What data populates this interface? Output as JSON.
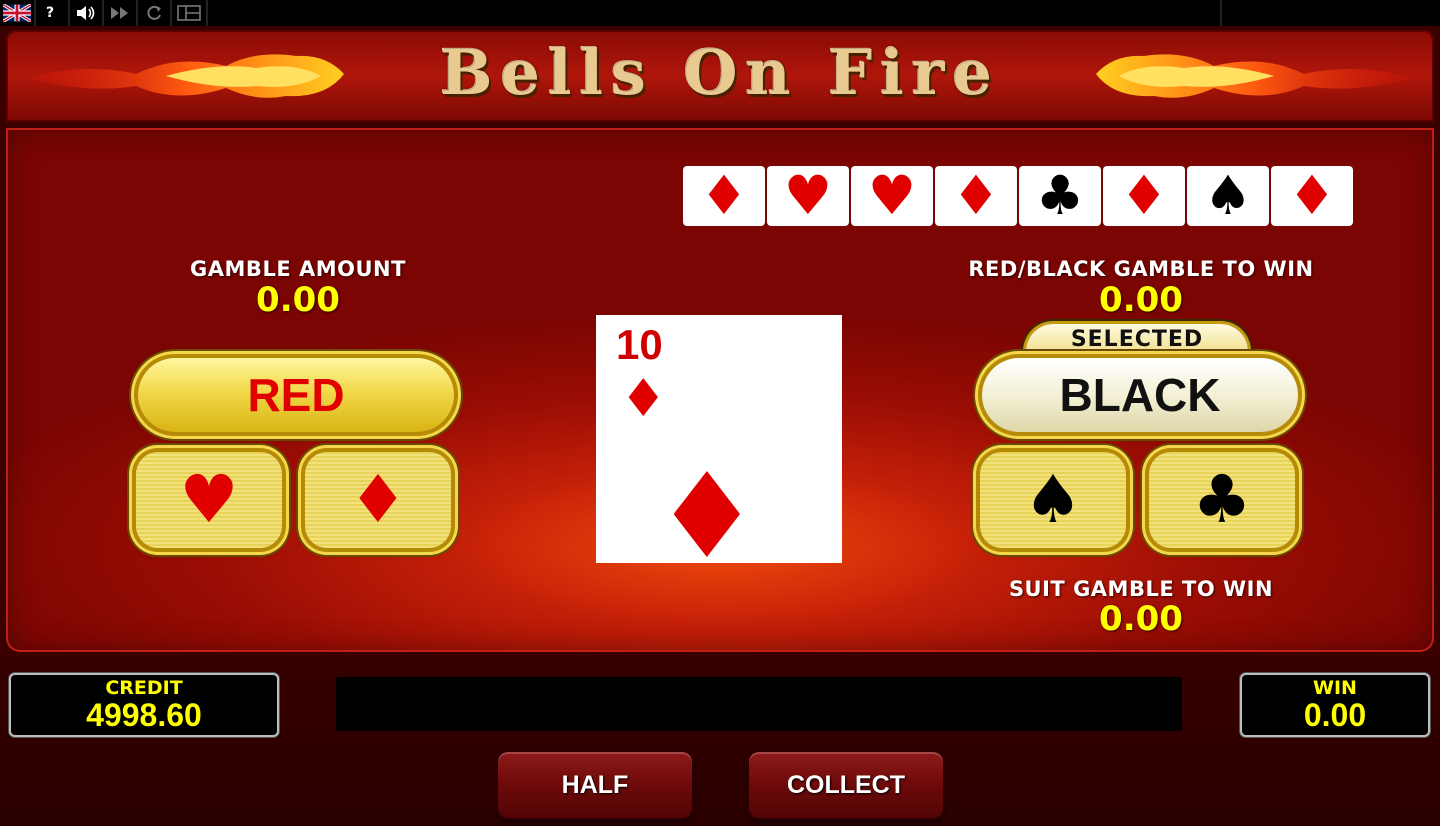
{
  "topbar": {
    "flag_icon": "uk-flag-icon",
    "help_label": "?",
    "sound_icon": "speaker-icon",
    "fast_forward_icon": "fast-forward-icon",
    "replay_icon": "replay-icon",
    "layout_icon": "layout-icon"
  },
  "header": {
    "title": "Bells On Fire"
  },
  "history": {
    "cards": [
      {
        "suit": "♦",
        "color": "red"
      },
      {
        "suit": "♥",
        "color": "red"
      },
      {
        "suit": "♥",
        "color": "red"
      },
      {
        "suit": "♦",
        "color": "red"
      },
      {
        "suit": "♣",
        "color": "black"
      },
      {
        "suit": "♦",
        "color": "red"
      },
      {
        "suit": "♠",
        "color": "black"
      },
      {
        "suit": "♦",
        "color": "red"
      }
    ]
  },
  "left_panel": {
    "gamble_amount_label": "GAMBLE AMOUNT",
    "gamble_amount_value": "0.00",
    "red_button_label": "RED",
    "heart_symbol": "♥",
    "diamond_symbol": "♦"
  },
  "right_panel": {
    "red_black_label": "RED/BLACK GAMBLE TO WIN",
    "red_black_value": "0.00",
    "selected_badge": "SELECTED",
    "black_button_label": "BLACK",
    "spade_symbol": "♠",
    "club_symbol": "♣",
    "suit_gamble_label": "SUIT GAMBLE TO WIN",
    "suit_gamble_value": "0.00"
  },
  "current_card": {
    "rank": "10",
    "suit": "♦"
  },
  "meters": {
    "credit_label": "CREDIT",
    "credit_value": "4998.60",
    "win_label": "WIN",
    "win_value": "0.00"
  },
  "message": "",
  "buttons": {
    "half_label": "HALF",
    "collect_label": "COLLECT"
  },
  "colors": {
    "accent_yellow": "#ffff00",
    "card_red": "#e00000",
    "board_red": "#c21e08"
  }
}
